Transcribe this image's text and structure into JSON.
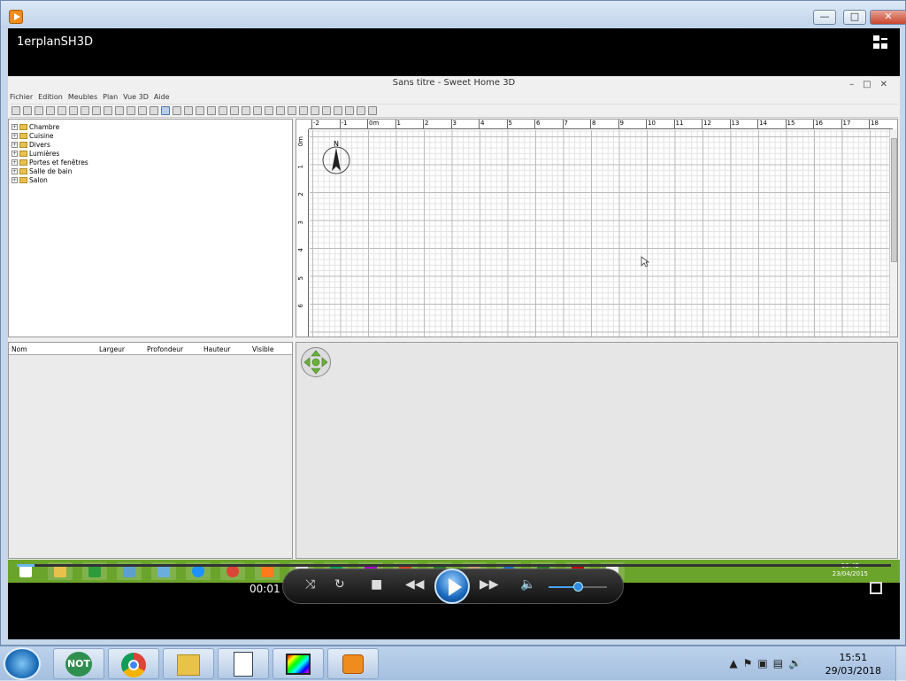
{
  "player": {
    "window_title": "1erplanSH3D",
    "elapsed_time": "00:01",
    "progress_fraction": 0.02,
    "volume_fraction": 0.5
  },
  "window_controls": {
    "minimize": "—",
    "maximize": "□",
    "close": "✕"
  },
  "sh3d": {
    "title": "Sans titre - Sweet Home 3D",
    "menu": [
      "Fichier",
      "Edition",
      "Meubles",
      "Plan",
      "Vue 3D",
      "Aide"
    ],
    "catalog": [
      "Chambre",
      "Cuisine",
      "Divers",
      "Lumières",
      "Portes et fenêtres",
      "Salle de bain",
      "Salon"
    ],
    "furniture_columns": [
      "Nom",
      "Largeur",
      "Profondeur",
      "Hauteur",
      "Visible"
    ],
    "ruler_h": [
      "-2",
      "-1",
      "0m",
      "1",
      "2",
      "3",
      "4",
      "5",
      "6",
      "7",
      "8",
      "9",
      "10",
      "11",
      "12",
      "13",
      "14",
      "15",
      "16",
      "17",
      "18"
    ],
    "ruler_v": [
      "0m",
      "1",
      "2",
      "3",
      "4",
      "5",
      "6"
    ],
    "compass_label": "N"
  },
  "video_taskbar": {
    "icons": [
      "windows-icon",
      "explorer-icon",
      "store-icon",
      "remote-icon",
      "network-icon",
      "ie-icon",
      "chrome-icon",
      "firefox-icon",
      "calc-icon",
      "drive-icon",
      "photo-icon",
      "powerpoint-icon",
      "camtasia-icon",
      "tool-icon",
      "globe-icon",
      "camtasia2-icon",
      "filezilla-icon",
      "sh3d-icon"
    ],
    "clock_time": "16:42",
    "clock_date": "23/04/2015",
    "bar_color": "#6ba42b"
  },
  "taskbar": {
    "buttons": [
      "NOT",
      "chrome",
      "explorer",
      "writer",
      "media",
      "player"
    ],
    "not_label": "NOT",
    "clock_time": "15:51",
    "clock_date": "29/03/2018"
  }
}
